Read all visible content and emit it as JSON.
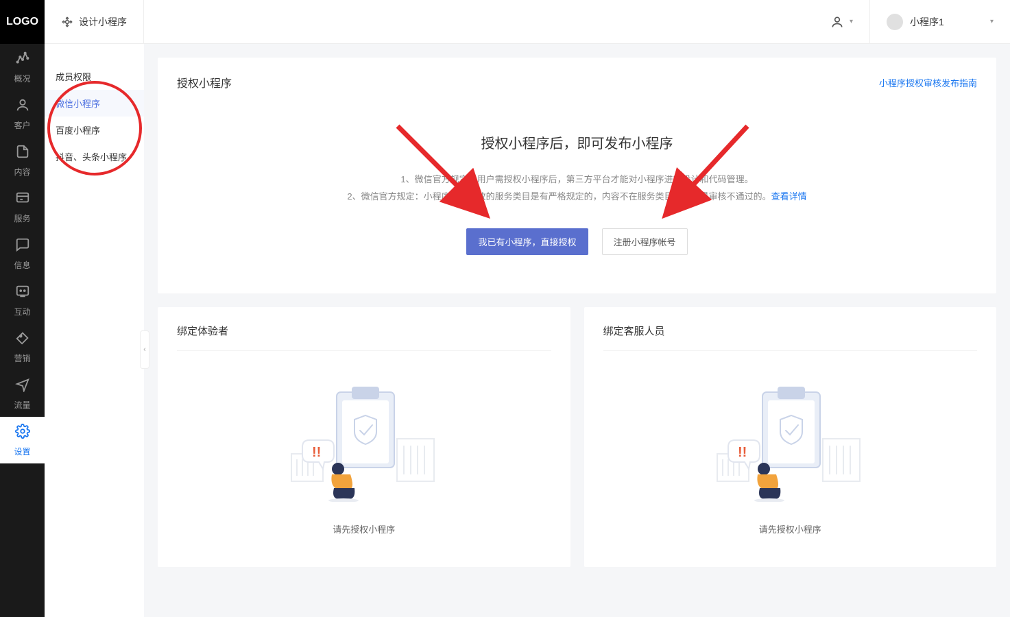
{
  "logo": "LOGO",
  "header": {
    "design_label": "设计小程序",
    "app_name": "小程序1"
  },
  "sidebar_dark": [
    {
      "icon": "overview",
      "label": "概况"
    },
    {
      "icon": "customer",
      "label": "客户"
    },
    {
      "icon": "content",
      "label": "内容"
    },
    {
      "icon": "service",
      "label": "服务"
    },
    {
      "icon": "message",
      "label": "信息"
    },
    {
      "icon": "interact",
      "label": "互动"
    },
    {
      "icon": "marketing",
      "label": "营销"
    },
    {
      "icon": "traffic",
      "label": "流量"
    },
    {
      "icon": "settings",
      "label": "设置",
      "active": true
    }
  ],
  "sub_sidebar": [
    {
      "label": "成员权限",
      "selected": false
    },
    {
      "label": "微信小程序",
      "selected": true
    },
    {
      "label": "百度小程序",
      "selected": false
    },
    {
      "label": "抖音、头条小程序",
      "selected": false
    }
  ],
  "main": {
    "panel_title": "授权小程序",
    "guide_link": "小程序授权审核发布指南",
    "auth_title": "授权小程序后，即可发布小程序",
    "line1_prefix": "1、微信官方规定：用户需授权小程序后，第三方平台才能对小程序进行设计和代码管理。",
    "line2_prefix": "2、微信官方规定：小程序个人开放的服务类目是有严格规定的，内容不在服务类目中的，是审核不通过的。",
    "line2_link": "查看详情",
    "btn_primary": "我已有小程序，直接授权",
    "btn_secondary": "注册小程序帐号"
  },
  "bottom": {
    "left_title": "绑定体验者",
    "right_title": "绑定客服人员",
    "empty_text": "请先授权小程序"
  }
}
